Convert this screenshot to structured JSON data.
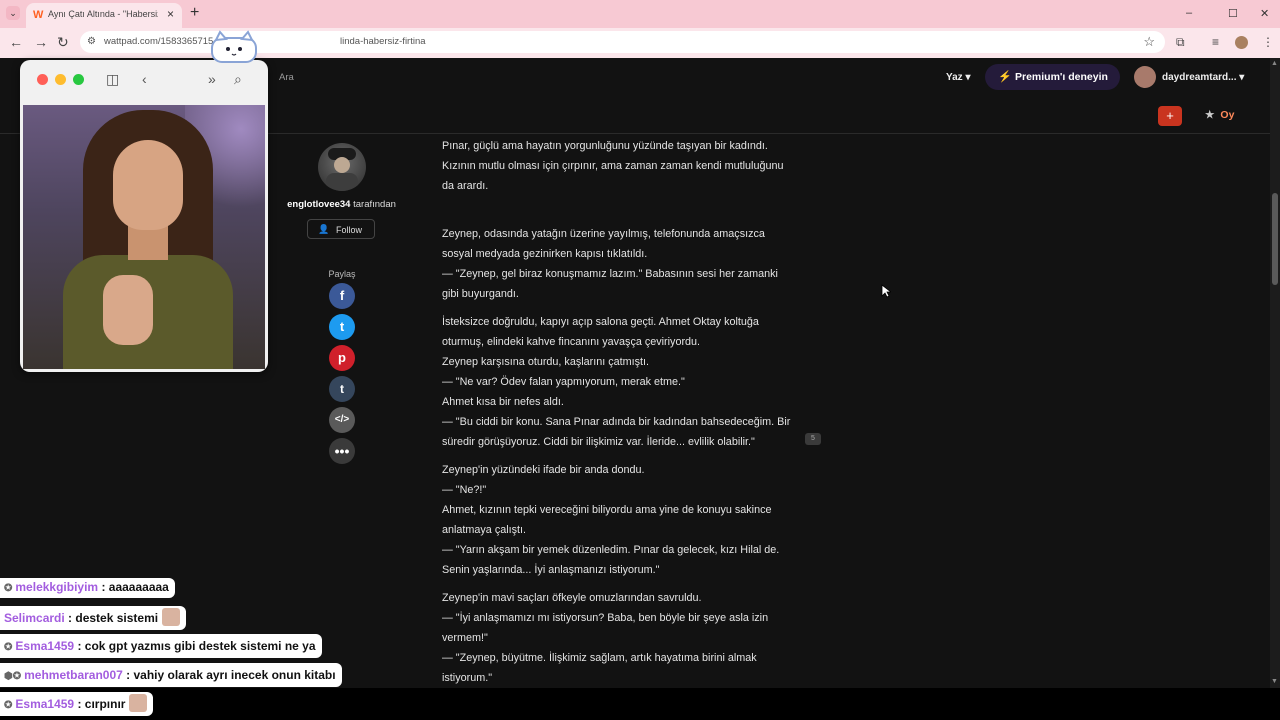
{
  "browser": {
    "tab_title": "Aynı Çatı Altında - \"Habersiz fı",
    "url_left": "wattpad.com/1583365715",
    "url_right": "linda-habersiz-firtina",
    "window_controls": [
      "–",
      "☐",
      "✕"
    ]
  },
  "wattpad": {
    "search_placeholder": "Ara",
    "write_label": "Yaz ▾",
    "premium_label": "Premium'ı deneyin",
    "username": "daydreamtard... ▾",
    "vote_label": "Oy",
    "add_label": "+",
    "author": {
      "name": "englotlovee34",
      "suffix": " tarafından",
      "follow_label": "Follow"
    },
    "share_label": "Paylaş",
    "share_icons": [
      "facebook-icon",
      "twitter-icon",
      "pinterest-icon",
      "tumblr-icon",
      "embed-icon",
      "more-icon"
    ],
    "comment_count": "5"
  },
  "story": {
    "paragraphs": [
      [
        "Pınar, güçlü ama hayatın yorgunluğunu yüzünde taşıyan bir kadındı.",
        "Kızının mutlu olması için çırpınır, ama zaman zaman kendi mutluluğunu",
        "da arardı."
      ],
      [
        "Zeynep, odasında yatağın üzerine yayılmış, telefonunda amaçsızca",
        "sosyal medyada gezinirken kapısı tıklatıldı.",
        "— \"Zeynep, gel biraz konuşmamız lazım.\" Babasının sesi her zamanki",
        "gibi buyurgandı."
      ],
      [
        "İsteksizce doğruldu, kapıyı açıp salona geçti. Ahmet Oktay koltuğa",
        "oturmuş, elindeki kahve fincanını yavaşça çeviriyordu.",
        "Zeynep karşısına oturdu, kaşlarını çatmıştı.",
        "— \"Ne var? Ödev falan yapmıyorum, merak etme.\"",
        "Ahmet kısa bir nefes aldı.",
        "— \"Bu ciddi bir konu. Sana Pınar adında bir kadından bahsedeceğim. Bir",
        "süredir görüşüyoruz. Ciddi bir ilişkimiz var. İleride... evlilik olabilir.\""
      ],
      [
        "Zeynep'in yüzündeki ifade bir anda dondu.",
        "— \"Ne?!\"",
        "Ahmet, kızının tepki vereceğini biliyordu ama yine de konuyu sakince",
        "anlatmaya çalıştı.",
        "— \"Yarın akşam bir yemek düzenledim. Pınar da gelecek, kızı Hilal de.",
        "Senin yaşlarında... İyi anlaşmanızı istiyorum.\""
      ],
      [
        "Zeynep'in mavi saçları öfkeyle omuzlarından savruldu.",
        "— \"İyi anlaşmamızı mı istiyorsun? Baba, ben böyle bir şeye asla izin",
        "vermem!\"",
        "— \"Zeynep, büyütme. İlişkimiz sağlam, artık hayatıma birini almak",
        "istiyorum.\""
      ]
    ]
  },
  "chat": [
    {
      "user": "melekkgibiyim",
      "message": " : aaaaaaaaa"
    },
    {
      "user": "Selimcardi",
      "message": " : destek sistemi"
    },
    {
      "user": "Esma1459",
      "message": " : cok gpt yazmıs gibi destek sistemi ne ya"
    },
    {
      "user": "mehmetbaran007",
      "message": " : vahiy olarak ayrı inecek onun kitabı"
    },
    {
      "user": "Esma1459",
      "message": " : cırpınır"
    }
  ],
  "colors": {
    "tabstrip": "#f7c9d3",
    "premium_bolt": "#c35bff",
    "vote": "#ff8a5b",
    "chat_user": "#a35ddf"
  }
}
